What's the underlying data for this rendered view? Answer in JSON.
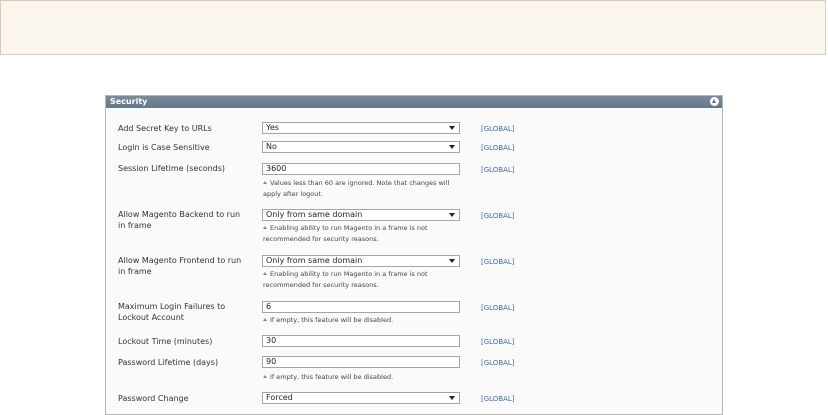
{
  "section": {
    "title": "Security",
    "collapse_icon": "chevron-up-icon"
  },
  "scope_label": "[GLOBAL]",
  "fields": [
    {
      "label": "Add Secret Key to URLs",
      "type": "select",
      "value": "Yes"
    },
    {
      "label": "Login is Case Sensitive",
      "type": "select",
      "value": "No"
    },
    {
      "label": "Session Lifetime (seconds)",
      "type": "input",
      "value": "3600",
      "note": "Values less than 60 are ignored. Note that changes will apply after logout."
    },
    {
      "label": "Allow Magento Backend to run in frame",
      "type": "select",
      "value": "Only from same domain",
      "note": "Enabling ability to run Magento in a frame is not recommended for security reasons."
    },
    {
      "label": "Allow Magento Frontend to run in frame",
      "type": "select",
      "value": "Only from same domain",
      "note": "Enabling ability to run Magento in a frame is not recommended for security reasons."
    },
    {
      "label": "Maximum Login Failures to Lockout Account",
      "type": "input",
      "value": "6",
      "note": "If empty, this feature will be disabled."
    },
    {
      "label": "Lockout Time (minutes)",
      "type": "input",
      "value": "30"
    },
    {
      "label": "Password Lifetime (days)",
      "type": "input",
      "value": "90",
      "note": "If empty, this feature will be disabled."
    },
    {
      "label": "Password Change",
      "type": "select",
      "value": "Forced"
    }
  ]
}
